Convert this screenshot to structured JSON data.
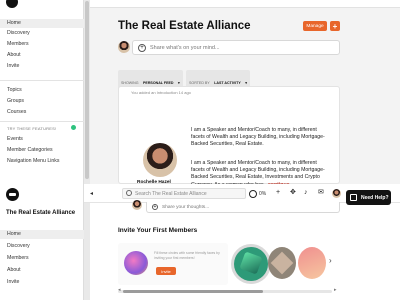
{
  "sidebar_top": {
    "items_main": [
      "Home",
      "Discovery",
      "Members",
      "About",
      "Invite"
    ],
    "items_mid": [
      "Topics",
      "Groups",
      "Courses"
    ],
    "featured_header": "TRY THESE FEATURES!",
    "items_featured": [
      "Events",
      "Member Categories",
      "Navigation Menu Links"
    ]
  },
  "main": {
    "title": "The Real Estate Alliance",
    "manage_label": "Manage",
    "add_label": "+",
    "composer_placeholder": "Share what's on your mind...",
    "filter_show_label": "SHOWING",
    "filter_show_value": "PERSONAL FEED",
    "filter_sort_label": "SORTED BY",
    "filter_sort_value": "LAST ACTIVITY"
  },
  "post": {
    "meta": "You added an Introduction 14 ago",
    "author": "Rochelle Hazel",
    "para1": "I am a Speaker and Mentor/Coach to many, in different facets of Wealth and Legacy Building, including Mortgage-Backed Securities, Real Estate.",
    "para2": "I am a Speaker and Mentor/Coach to many, in different facets of Wealth and Legacy Building, including Mortgage-Backed Securities, Real Estate, Investments and Crypto Currency. As a woman who has...",
    "continue_label": "continue"
  },
  "help": {
    "label": "Need Help?"
  },
  "lower": {
    "brand_title": "The Real Estate Alliance",
    "nav_items": [
      "Home",
      "Discovery",
      "Members",
      "About",
      "Invite"
    ],
    "search_placeholder": "Search The Real Estate Alliance",
    "progress_text": "0%",
    "composer_placeholder": "Share your thoughts...",
    "invite_title": "Invite Your First Members",
    "invite_hint": "Fill these circles with some friendly faces by inviting your first members!",
    "invite_button": "Invite"
  },
  "colors": {
    "accent": "#e8662b",
    "continue": "#c0372a",
    "featured_dot": "#2ec27e"
  }
}
